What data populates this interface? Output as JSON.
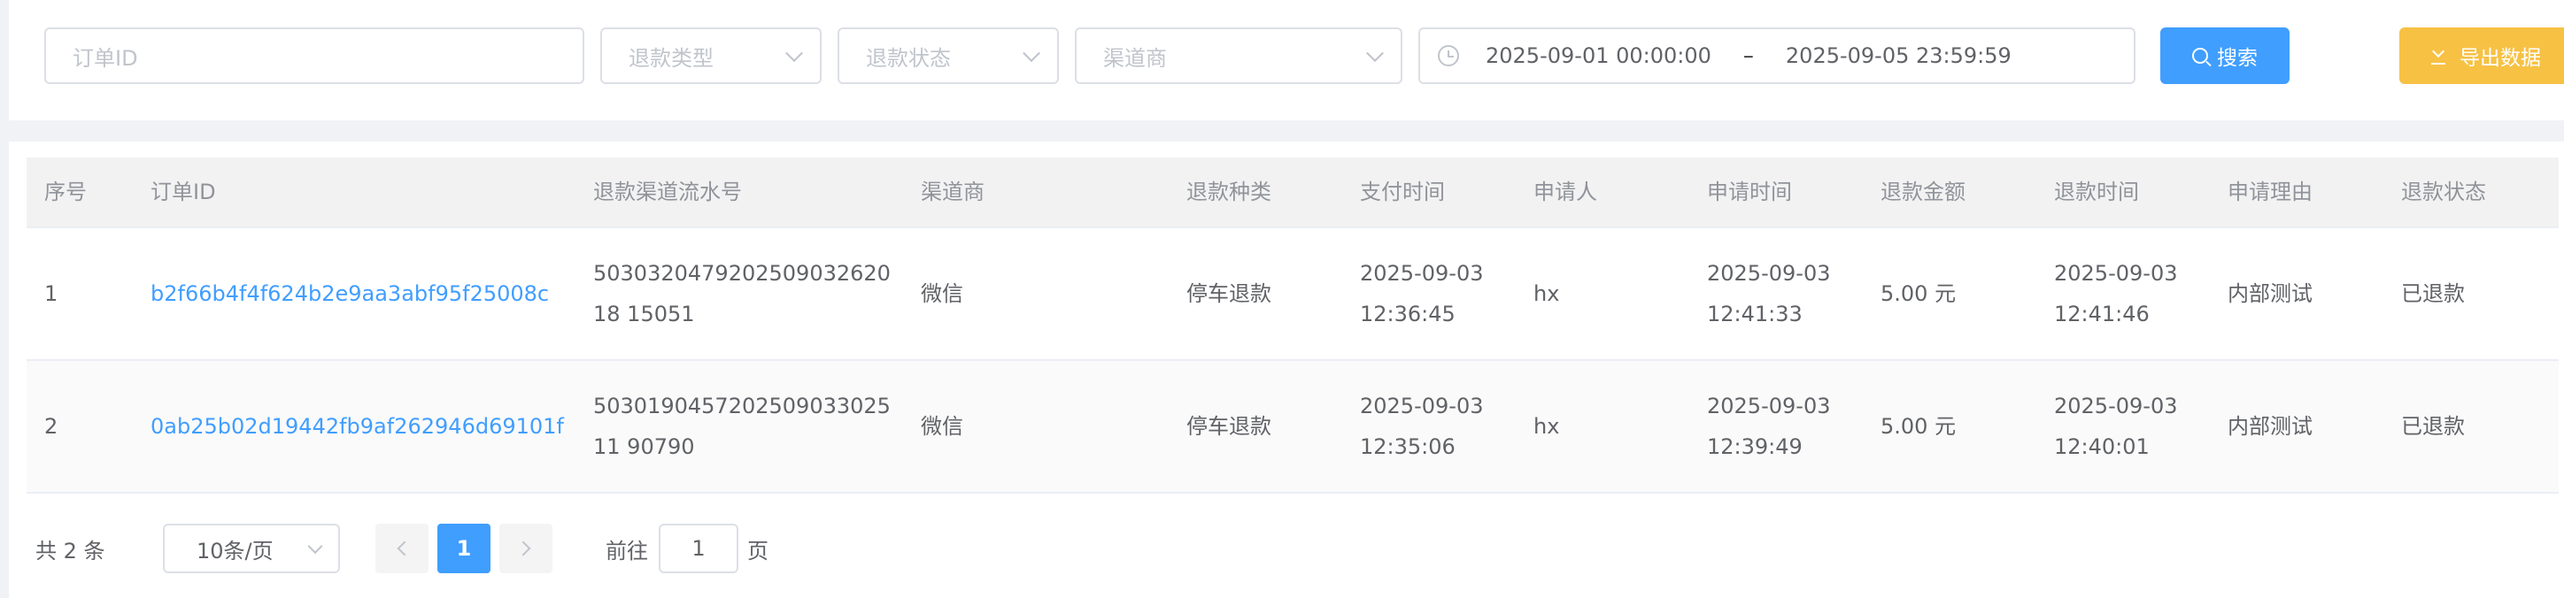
{
  "filters": {
    "order_id_placeholder": "订单ID",
    "refund_type_placeholder": "退款类型",
    "refund_status_placeholder": "退款状态",
    "channel_placeholder": "渠道商",
    "date_start": "2025-09-01 00:00:00",
    "date_separator": "–",
    "date_end": "2025-09-05 23:59:59",
    "search_label": "搜索",
    "export_label": "导出数据"
  },
  "table": {
    "columns": [
      "序号",
      "订单ID",
      "退款渠道流水号",
      "渠道商",
      "退款种类",
      "支付时间",
      "申请人",
      "申请时间",
      "退款金额",
      "退款时间",
      "申请理由",
      "退款状态"
    ],
    "rows": [
      [
        "1",
        "b2f66b4f4f624b2e9aa3abf95f25008c",
        "503032047920250903262018 15051",
        "微信",
        "停车退款",
        "2025-09-03 12:36:45",
        "hx",
        "2025-09-03 12:41:33",
        "5.00 元",
        "2025-09-03 12:41:46",
        "内部测试",
        "已退款"
      ],
      [
        "2",
        "0ab25b02d19442fb9af262946d69101f",
        "503019045720250903302511 90790",
        "微信",
        "停车退款",
        "2025-09-03 12:35:06",
        "hx",
        "2025-09-03 12:39:49",
        "5.00 元",
        "2025-09-03 12:40:01",
        "内部测试",
        "已退款"
      ]
    ]
  },
  "pagination": {
    "total_label": "共 2 条",
    "page_size": "10条/页",
    "current_page": "1",
    "goto_label": "前往",
    "goto_value": "1",
    "goto_suffix": "页"
  },
  "colors": {
    "primary": "#409eff",
    "export": "#f7c144",
    "link": "#409eff"
  },
  "icons": {
    "date": "clock-icon",
    "search": "search-icon",
    "export": "download-icon",
    "dropdown": "chevron-down-icon",
    "prev": "chevron-left-icon",
    "next": "chevron-right-icon"
  }
}
